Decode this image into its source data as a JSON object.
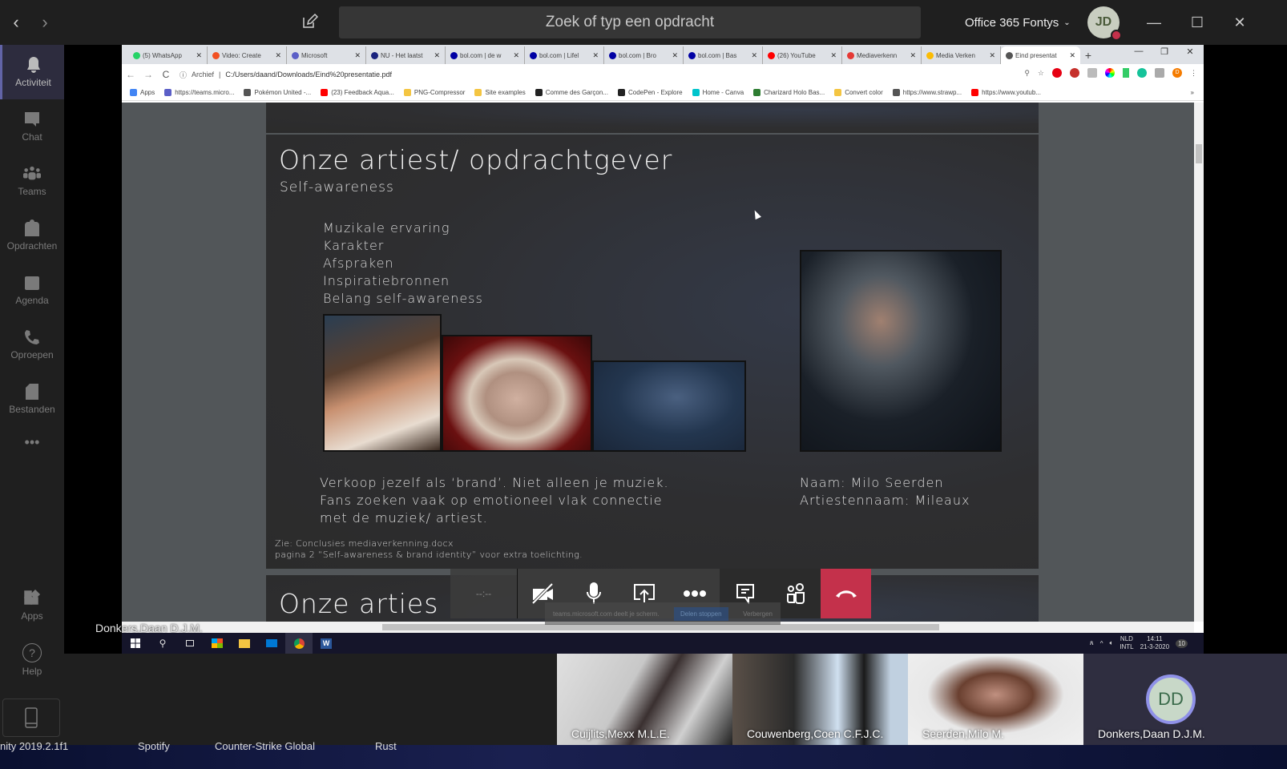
{
  "titlebar": {
    "back_icon": "chevron-left-icon",
    "forward_icon": "chevron-right-icon",
    "compose_icon": "compose-icon",
    "search_placeholder": "Zoek of typ een opdracht",
    "tenant": "Office 365 Fontys",
    "avatar_initials": "JD",
    "minimize": "—",
    "maximize": "☐",
    "close": "✕"
  },
  "rail": {
    "items": [
      {
        "label": "Activiteit",
        "icon": "bell-icon",
        "active": true
      },
      {
        "label": "Chat",
        "icon": "chat-icon"
      },
      {
        "label": "Teams",
        "icon": "teams-icon"
      },
      {
        "label": "Opdrachten",
        "icon": "backpack-icon"
      },
      {
        "label": "Agenda",
        "icon": "calendar-icon"
      },
      {
        "label": "Oproepen",
        "icon": "phone-icon"
      },
      {
        "label": "Bestanden",
        "icon": "file-icon"
      }
    ],
    "more": "•••",
    "apps": "Apps",
    "help": "Help"
  },
  "browser": {
    "tabs": [
      {
        "label": "(5) WhatsApp",
        "color": "#25d366"
      },
      {
        "label": "Video: Create",
        "color": "#f25022"
      },
      {
        "label": "Microsoft",
        "color": "#5b5fc7"
      },
      {
        "label": "NU - Het laatst",
        "color": "#1a237e"
      },
      {
        "label": "bol.com | de w",
        "color": "#0000a4"
      },
      {
        "label": "bol.com | Lifel",
        "color": "#0000a4"
      },
      {
        "label": "bol.com | Bro",
        "color": "#0000a4"
      },
      {
        "label": "bol.com | Bas",
        "color": "#0000a4"
      },
      {
        "label": "(26) YouTube",
        "color": "#ff0000"
      },
      {
        "label": "Mediaverkenn",
        "color": "#e53935"
      },
      {
        "label": "Media Verken",
        "color": "#fbbc04"
      },
      {
        "label": "Eind presentat",
        "color": "#555555",
        "active": true
      }
    ],
    "new_tab": "+",
    "win_min": "—",
    "win_restore": "❐",
    "win_close": "✕",
    "back": "←",
    "forward": "→",
    "reload": "C",
    "info": "ⓘ",
    "origin": "Archief",
    "url": "C:/Users/daand/Downloads/Eind%20presentatie.pdf",
    "profile_initial": "D",
    "bookmarks": [
      {
        "label": "Apps",
        "color": "#4285f4"
      },
      {
        "label": "https://teams.micro...",
        "color": "#5b5fc7"
      },
      {
        "label": "Pokémon United -...",
        "color": "#555555"
      },
      {
        "label": "(23) Feedback Aqua...",
        "color": "#ff0000"
      },
      {
        "label": "PNG-Compressor",
        "color": "#f4c542"
      },
      {
        "label": "Site examples",
        "color": "#f4c542"
      },
      {
        "label": "Comme des Garçon...",
        "color": "#222222"
      },
      {
        "label": "CodePen - Explore",
        "color": "#222222"
      },
      {
        "label": "Home - Canva",
        "color": "#00c4cc"
      },
      {
        "label": "Charizard Holo Bas...",
        "color": "#2e7d32"
      },
      {
        "label": "Convert color",
        "color": "#f4c542"
      },
      {
        "label": "https://www.strawp...",
        "color": "#555555"
      },
      {
        "label": "https://www.youtub...",
        "color": "#ff0000"
      }
    ],
    "bookmarks_more": "»"
  },
  "slide": {
    "title": "Onze artiest/ opdrachtgever",
    "subtitle": "Self-awareness",
    "bullets": [
      "Muzikale ervaring",
      "Karakter",
      "Afspraken",
      "Inspiratiebronnen",
      "Belang self-awareness"
    ],
    "body": [
      "Verkoop jezelf als ‘brand’. Niet alleen je muziek.",
      "Fans zoeken vaak op emotioneel vlak connectie",
      "met de muziek/ artiest."
    ],
    "info": [
      "Naam: Milo Seerden",
      "Artiestennaam: Mileaux"
    ],
    "note": [
      "Zie: Conclusies mediaverkenning.docx",
      "pagina 2 “Self-awareness & brand identity” voor extra toelichting."
    ],
    "next_title": "Onze arties"
  },
  "call": {
    "timer": "--:--",
    "share_notice": "teams.microsoft.com deelt je scherm.",
    "stop_sharing": "Delen stoppen",
    "hide": "Verbergen",
    "presenter": "Donkers,Daan D.J.M."
  },
  "taskbar": {
    "lang": "NLD",
    "layout": "INTL",
    "time": "14:11",
    "date": "21-3-2020",
    "notifications": "10"
  },
  "participants": [
    {
      "name": "Cuijlits,Mexx M.L.E."
    },
    {
      "name": "Couwenberg,Coen C.F.J.C."
    },
    {
      "name": "Seerden,Milo M."
    },
    {
      "name": "Donkers,Daan D.J.M.",
      "initials": "DD"
    }
  ],
  "desktop": [
    "nity 2019.2.1f1",
    "Spotify",
    "Counter-Strike Global",
    "Rust"
  ]
}
